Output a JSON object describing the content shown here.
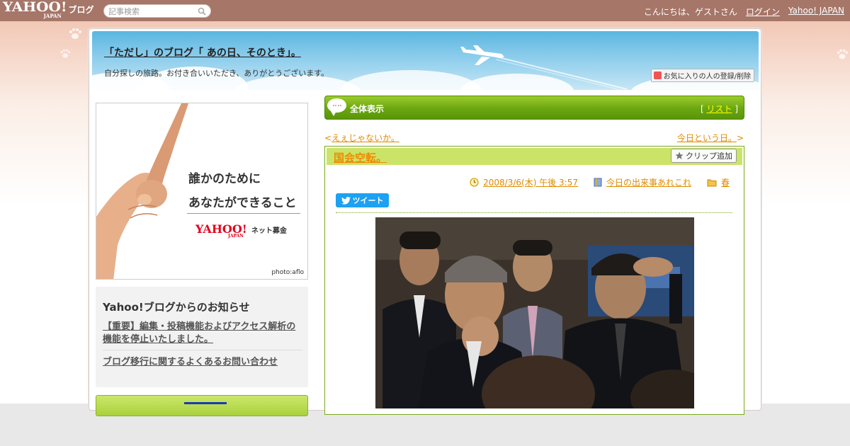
{
  "masthead": {
    "logo_yahoo": "YAHOO!",
    "logo_japan": "JAPAN",
    "logo_blog": "ブログ",
    "search_placeholder": "記事検索",
    "greeting": "こんにちは、ゲストさん",
    "login": "ログイン",
    "yahoo_japan": "Yahoo! JAPAN"
  },
  "blog": {
    "title": "「ただし」のブログ「 あの日、そのとき」。",
    "subtitle": "自分探しの旅路。お付き合いいただき、ありがとうございます。",
    "favorite_button": "お気に入りの人の登録/削除"
  },
  "ad": {
    "line1": "誰かのために",
    "line2": "あなたができること",
    "logo_yahoo": "YAHOO!",
    "logo_japan": "JAPAN",
    "tagline": "ネット募金",
    "credit": "photo:aflo"
  },
  "notice": {
    "title": "Yahoo!ブログからのお知らせ",
    "link1": "【重要】編集・投稿機能およびアクセス解析の機能を停止いたしました。",
    "link2": "ブログ移行に関するよくあるお問い合わせ"
  },
  "section": {
    "title": "全体表示",
    "list_open": "[",
    "list_label": "リスト",
    "list_close": "]"
  },
  "pager": {
    "prev_mark": "<",
    "prev": "えぇじゃないか。",
    "next": "今日という日。",
    "next_mark": ">"
  },
  "article": {
    "title": "国会空転。",
    "clip_button": "クリップ追加",
    "date": "2008/3/6(木) 午後 3:57",
    "category": "今日の出来事あれこれ",
    "folder": "春",
    "tweet": "ツイート"
  },
  "colors": {
    "masthead": "#a67668",
    "green_bar": "#6aa612",
    "link_orange": "#e08a00",
    "title_orange": "#f08a00"
  }
}
